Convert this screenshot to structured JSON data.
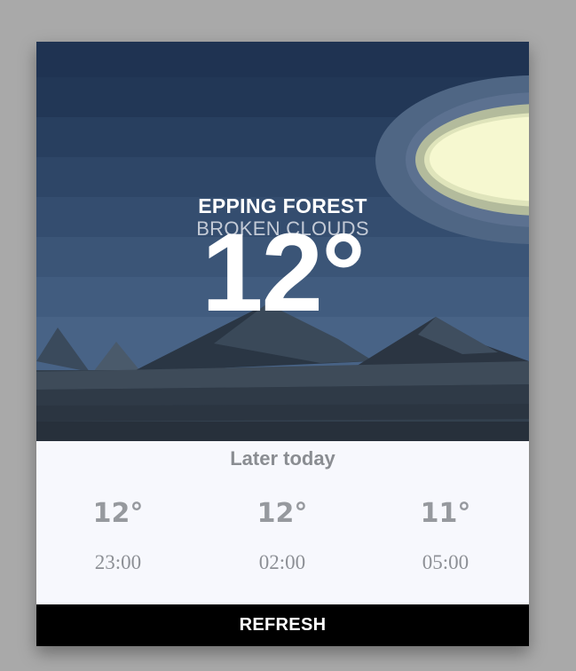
{
  "weather": {
    "location": "EPPING FOREST",
    "condition": "BROKEN CLOUDS",
    "temperature": "12°",
    "scene_icon": "night-mountains-moon"
  },
  "later": {
    "title": "Later today",
    "items": [
      {
        "temp": "12°",
        "time": "23:00"
      },
      {
        "temp": "12°",
        "time": "02:00"
      },
      {
        "temp": "11°",
        "time": "05:00"
      }
    ]
  },
  "actions": {
    "refresh_label": "REFRESH"
  },
  "colors": {
    "sky_top": "#1f3350",
    "sky_bottom": "#4f6a8c",
    "moon": "#f6f8d0",
    "panel": "#f7f8fd",
    "button": "#000000"
  }
}
